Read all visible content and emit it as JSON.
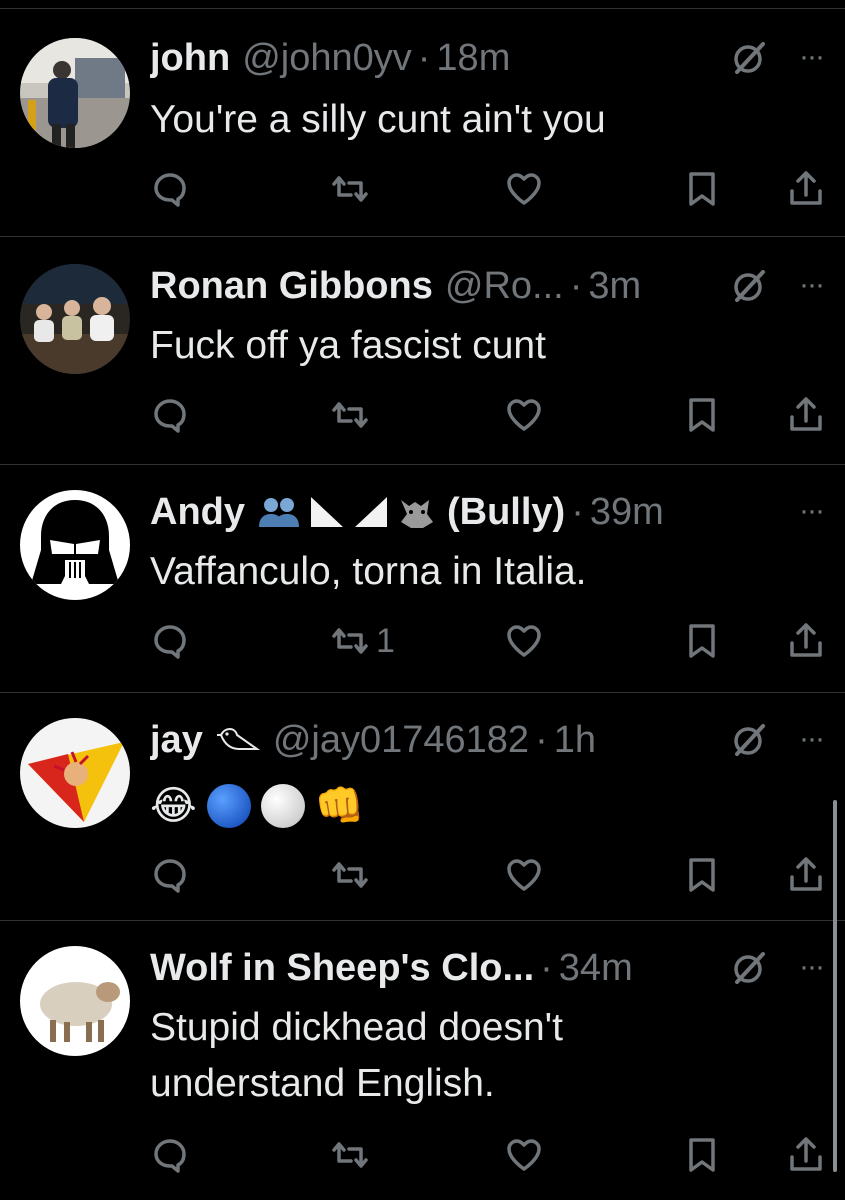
{
  "tweets": [
    {
      "name": "john",
      "handle": "@john0yv",
      "time": "18m",
      "text": "You're a silly cunt ain't you",
      "retweets": ""
    },
    {
      "name": "Ronan Gibbons",
      "handle": "@Ro...",
      "time": "3m",
      "text": "Fuck off ya fascist cunt",
      "retweets": ""
    },
    {
      "name": "Andy",
      "name_suffix": "(Bully)",
      "handle": "",
      "time": "39m",
      "text": "Vaffanculo, torna in Italia.",
      "retweets": "1"
    },
    {
      "name": "jay",
      "handle": "@jay01746182",
      "time": "1h",
      "emoji_text": [
        "😂",
        "blue-circle",
        "white-circle",
        "👊"
      ],
      "retweets": ""
    },
    {
      "name": "Wolf in Sheep's Clo...",
      "handle": "",
      "time": "34m",
      "text_lines": [
        "Stupid dickhead doesn't",
        "understand English."
      ],
      "retweets": ""
    }
  ],
  "separator": "·",
  "more_label": "···",
  "icons": {
    "reply": "reply-icon",
    "retweet": "retweet-icon",
    "like": "heart-icon",
    "bookmark": "bookmark-icon",
    "share": "share-icon",
    "grok": "grok-icon"
  },
  "colors": {
    "background": "#000000",
    "text": "#e7e9ea",
    "muted": "#71767b",
    "divider": "#2f3336"
  }
}
